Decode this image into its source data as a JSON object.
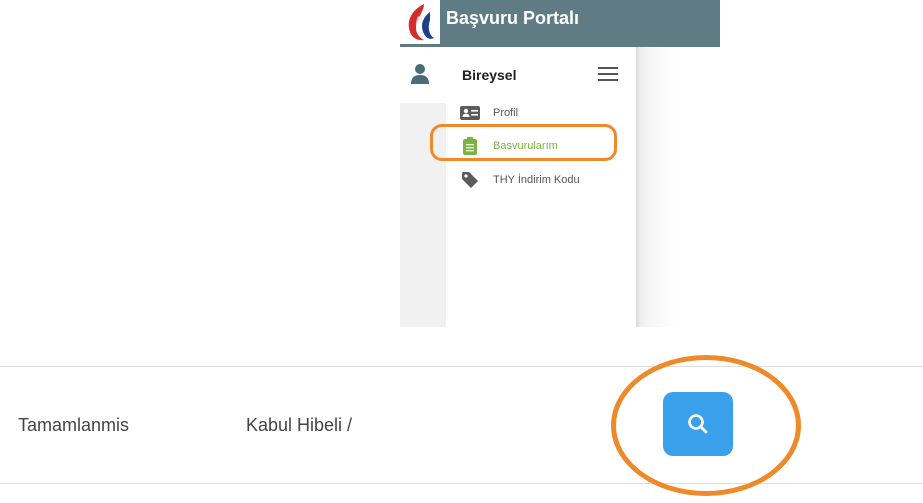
{
  "portal": {
    "title": "Başvuru Portalı",
    "header_color": "#5f7c84",
    "logo_icon": "flame-logo-icon"
  },
  "sidebar": {
    "section_title": "Bireysel",
    "user_icon": "user-icon",
    "menu_icon": "hamburger-icon",
    "items": [
      {
        "label": "Profil",
        "icon": "id-card-icon",
        "active": false
      },
      {
        "label": "Basvurularım",
        "icon": "clipboard-icon",
        "active": true
      },
      {
        "label": "THY İndirim Kodu",
        "icon": "tag-icon",
        "active": false
      }
    ],
    "active_color": "#7cb342"
  },
  "table_row": {
    "status": "Tamamlanmis",
    "type": "Kabul Hibeli /",
    "action_icon": "search-icon",
    "action_color": "#3aa0ec"
  },
  "annotations": {
    "highlight_color": "#ef8a2a"
  }
}
